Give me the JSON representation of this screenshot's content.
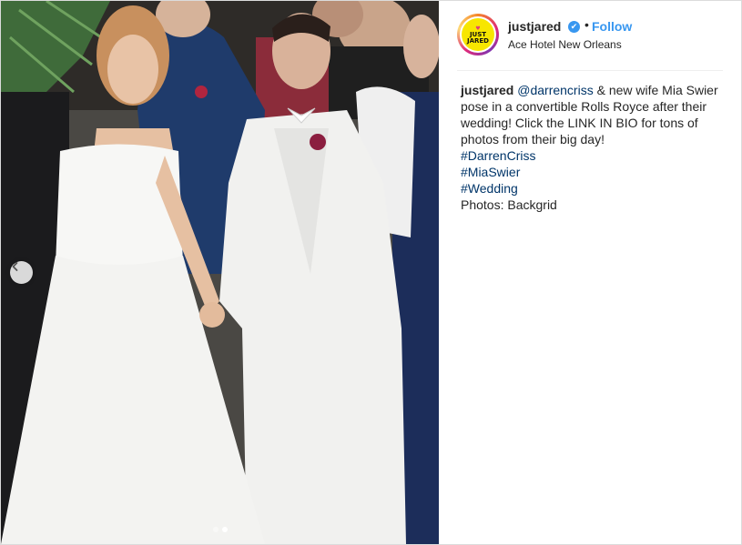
{
  "post": {
    "username": "justjared",
    "separator": "•",
    "follow_label": "Follow",
    "location": "Ace Hotel New Orleans",
    "avatar_text_line1": "JUST",
    "avatar_text_line2": "JARED",
    "avatar_heart": "♥",
    "verified_mark": "✔"
  },
  "caption": {
    "username": "justjared",
    "mention": "@darrencriss",
    "text": " & new wife Mia Swier pose in a convertible Rolls Royce after their wedding! Click the LINK IN BIO for tons of photos from their big day!",
    "hashtags": [
      "#DarrenCriss",
      "#MiaSwier",
      "#Wedding"
    ],
    "credit": "Photos: Backgrid"
  },
  "carousel": {
    "prev_icon": "‹",
    "slides": 2,
    "active_index": 1
  },
  "colors": {
    "accent": "#3897f0",
    "link": "#003569",
    "text": "#262626",
    "avatar_bg": "#f7e600"
  }
}
